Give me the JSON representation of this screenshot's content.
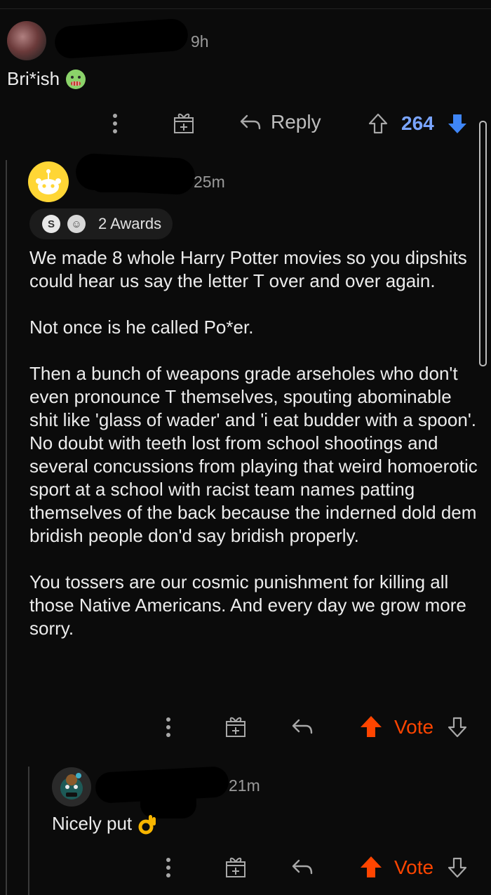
{
  "comment1": {
    "time": "9h",
    "text": "Bri*ish",
    "emoji": "sick-face",
    "reply_label": "Reply",
    "score": "264"
  },
  "comment2": {
    "time": "25m",
    "awards_label": "2 Awards",
    "paragraphs": [
      "We made 8 whole Harry Potter movies so you dipshits could hear us say the letter T over and over again.",
      "Not once is he called Po*er.",
      "Then a bunch of weapons grade arseholes who don't even pronounce T themselves, spouting abominable shit like 'glass of wader' and 'i eat budder with a spoon'. No doubt with teeth lost from school shootings and several concussions from playing that weird homoerotic sport at a school with racist team names patting themselves of the back because the inderned dold dem bridish people don'd say bridish properly.",
      "You tossers are our cosmic punishment for killing all those Native Americans. And every day we grow more sorry."
    ],
    "vote_label": "Vote"
  },
  "comment3": {
    "time": "21m",
    "text": "Nicely put",
    "emoji": "ok-hand",
    "vote_label": "Vote"
  },
  "colors": {
    "background": "#0b0b0b",
    "upvote_orange": "#ff4500",
    "score_blue": "#7aa5ff",
    "downvote_blue": "#3f86f7"
  }
}
